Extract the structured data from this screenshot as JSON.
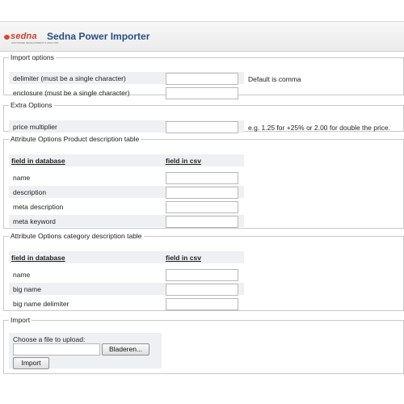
{
  "header": {
    "logo_text": "sedna",
    "logo_tagline": "SOFTWARE DEVELOPMENT & ANALYSIS",
    "title": "Sedna Power Importer"
  },
  "import_options": {
    "legend": "Import options",
    "delimiter_label": "delimiter (must be a single character)",
    "delimiter_value": "",
    "delimiter_note": "Default is comma",
    "enclosure_label": "enclosure (must be a single character)",
    "enclosure_value": ""
  },
  "extra_options": {
    "legend": "Extra Options",
    "multiplier_label": "price multiplier",
    "multiplier_value": "",
    "multiplier_note": "e.g. 1.25 for +25% or 2.00 for double the price."
  },
  "product_table": {
    "legend": "Attribute Options Product description table",
    "col_db": "field in database",
    "col_csv": "field in csv",
    "rows": [
      {
        "label": "name",
        "value": ""
      },
      {
        "label": "description",
        "value": ""
      },
      {
        "label": "meta description",
        "value": ""
      },
      {
        "label": "meta keyword",
        "value": ""
      }
    ]
  },
  "category_table": {
    "legend": "Attribute Options category description table",
    "col_db": "field in database",
    "col_csv": "field in csv",
    "rows": [
      {
        "label": "name",
        "value": ""
      },
      {
        "label": "big name",
        "value": ""
      },
      {
        "label": "big name delimiter",
        "value": ""
      }
    ]
  },
  "import_section": {
    "legend": "Import",
    "choose_label": "Choose a file to upload:",
    "browse_label": "Bladeren...",
    "import_label": "Import"
  }
}
